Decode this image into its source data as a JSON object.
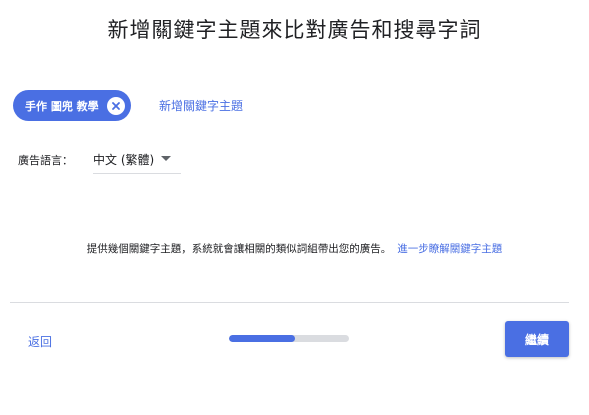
{
  "header": {
    "title": "新增關鍵字主題來比對廣告和搜尋字詞"
  },
  "keywords": {
    "chips": [
      {
        "label": "手作 圖兜 教學",
        "remove_icon": "close-circle-icon"
      }
    ],
    "add_label": "新增關鍵字主題"
  },
  "language": {
    "label": "廣告語言：",
    "selected": "中文 (繁體)",
    "dropdown_icon": "caret-down-icon"
  },
  "info": {
    "text": "提供幾個關鍵字主題，系統就會讓相關的類似詞組帶出您的廣告。",
    "link": "進一步瞭解關鍵字主題"
  },
  "footer": {
    "back_label": "返回",
    "progress": 0.55,
    "continue_label": "繼續"
  },
  "colors": {
    "accent": "#4a6fe3",
    "track": "#dadce0",
    "text": "#202124"
  }
}
